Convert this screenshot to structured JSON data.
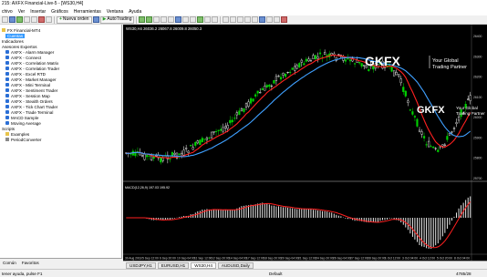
{
  "window": {
    "title": "215: AXFX Financial-Live-5 - [WS30,H4]"
  },
  "menu": [
    "chivo",
    "Ver",
    "Insertar",
    "Gráficos",
    "Herramientas",
    "Ventana",
    "Ayuda"
  ],
  "toolbar": {
    "new_order": "Nueva orden",
    "autotrading": "AutoTrading"
  },
  "navigator": {
    "rows": [
      {
        "label": "FX Financial-MT4",
        "icon": "folder-icon",
        "indent": 0
      },
      {
        "label": "Cuentas",
        "icon": "",
        "indent": 1,
        "selected": true
      },
      {
        "label": "Indicadores",
        "icon": "",
        "indent": 0
      },
      {
        "label": "Asesores Expertos",
        "icon": "",
        "indent": 0
      },
      {
        "label": "AXFX - Alarm Manager",
        "icon": "expert-icon",
        "indent": 1
      },
      {
        "label": "AXFX - Connect",
        "icon": "expert-icon",
        "indent": 1
      },
      {
        "label": "AXFX - Correlation Matrix",
        "icon": "expert-icon",
        "indent": 1
      },
      {
        "label": "AXFX - Correlation Trader",
        "icon": "expert-icon",
        "indent": 1
      },
      {
        "label": "AXFX - Excel RTD",
        "icon": "expert-icon",
        "indent": 1
      },
      {
        "label": "AXFX - Market Manager",
        "icon": "expert-icon",
        "indent": 1
      },
      {
        "label": "AXFX - Mini Terminal",
        "icon": "expert-icon",
        "indent": 1
      },
      {
        "label": "AXFX - Sentiment Trader",
        "icon": "expert-icon",
        "indent": 1
      },
      {
        "label": "AXFX - Session Map",
        "icon": "expert-icon",
        "indent": 1
      },
      {
        "label": "AXFX - Stealth Orders",
        "icon": "expert-icon",
        "indent": 1
      },
      {
        "label": "AXFX - Tick Chart Trader",
        "icon": "expert-icon",
        "indent": 1
      },
      {
        "label": "AXFX - Trade Terminal",
        "icon": "expert-icon",
        "indent": 1
      },
      {
        "label": "MACD Sample",
        "icon": "expert-icon",
        "indent": 1
      },
      {
        "label": "Moving Average",
        "icon": "expert-icon",
        "indent": 1
      },
      {
        "label": "Scripts",
        "icon": "",
        "indent": 0
      },
      {
        "label": "Examples",
        "icon": "folder-icon",
        "indent": 1
      },
      {
        "label": "PeriodConverter",
        "icon": "script-icon",
        "indent": 1
      }
    ],
    "tabs": [
      "Común",
      "Favoritos"
    ]
  },
  "chart": {
    "header": "WS30,H4  26036.2 26067.8 26009.8 26050.3",
    "brand_name": "GKFX",
    "brand_tag1": "Your Global",
    "brand_tag2": "Trading Partner",
    "osma_label": "MACD(12,26,9) 197.03 195.92",
    "price_labels": [
      "26400",
      "26300",
      "26200",
      "26100",
      "26000",
      "25900",
      "25800",
      "25700"
    ],
    "time_labels": [
      "30 Aug 2018",
      "5 Sep 12:00",
      "6 Sep 20:00",
      "10 Sep 04:00",
      "11 Sep 12:00",
      "12 Sep 20:00",
      "14 Sep 04:00",
      "17 Sep 12:00",
      "18 Sep 20:00",
      "20 Sep 04:00",
      "21 Sep 12:00",
      "24 Sep 20:00",
      "26 Sep 04:00",
      "27 Sep 12:00",
      "28 Sep 20:00",
      "1 Oct 12:00",
      "3 Oct 04:00",
      "4 Oct 12:00",
      "5 Oct 20:00",
      "8 Oct 04:00"
    ],
    "colors": {
      "bull": "#00d000",
      "bear": "#ffffff",
      "ma_fast": "#ff2020",
      "ma_slow": "#3fa0ff",
      "osc": "#ffffff",
      "osc_signal": "#ff2020"
    }
  },
  "chart_tabs": [
    {
      "label": "USDJPY,H1",
      "active": false
    },
    {
      "label": "EURUSD,H1",
      "active": false
    },
    {
      "label": "WS30,H4",
      "active": true
    },
    {
      "label": "AUDUSD,Daily",
      "active": false
    }
  ],
  "status": {
    "help": "tener ayuda, pulse F1",
    "profile": "Default",
    "traffic": "4785/28"
  }
}
